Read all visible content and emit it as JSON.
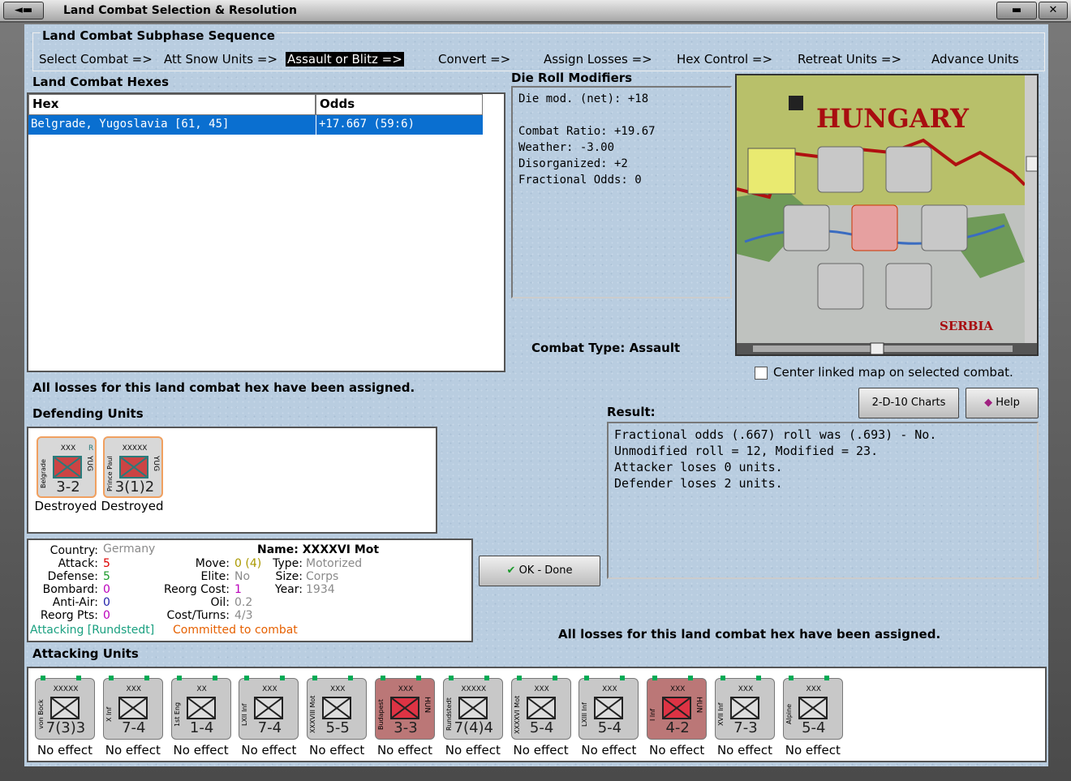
{
  "window": {
    "title": "Land Combat Selection & Resolution"
  },
  "sequence": {
    "header": "Land Combat Subphase Sequence",
    "steps": [
      "Select Combat =>",
      "Att Snow Units =>",
      "Assault or Blitz =>",
      "Convert =>",
      "Assign Losses =>",
      "Hex Control =>",
      "Retreat Units =>",
      "Advance Units"
    ]
  },
  "hexes": {
    "header": "Land Combat Hexes",
    "col_hex": "Hex",
    "col_odds": "Odds",
    "rows": [
      {
        "hex": "Belgrade, Yugoslavia [61, 45]",
        "odds": "+17.667 (59:6)"
      }
    ]
  },
  "modifiers": {
    "header": "Die Roll Modifiers",
    "net": "Die mod. (net): +18",
    "lines": [
      "Combat Ratio: +19.67",
      "Weather: -3.00",
      "Disorganized: +2",
      "Fractional Odds: 0"
    ]
  },
  "combat_type": {
    "label": "Combat Type:",
    "value": "Assault"
  },
  "map": {
    "region1": "HUNGARY",
    "region2": "SERBIA",
    "center_link_label": "Center linked map on selected combat."
  },
  "losses_msg": "All losses for this land combat hex have been assigned.",
  "defending": {
    "header": "Defending Units",
    "units": [
      {
        "name": "Belgrade",
        "nation": "YUG",
        "size": "XXX",
        "value": "3-2",
        "status": "Destroyed",
        "flag": "R"
      },
      {
        "name": "Prince Paul",
        "nation": "YUG",
        "size": "XXXXX",
        "value": "3(1)2",
        "status": "Destroyed"
      }
    ]
  },
  "buttons": {
    "charts": "2-D-10 Charts",
    "help": "Help",
    "ok": "OK - Done"
  },
  "result": {
    "header": "Result:",
    "lines": [
      "Fractional odds (.667) roll was (.693)  - No.",
      "Unmodified roll = 12, Modified = 23.",
      "Attacker loses 0 units.",
      "Defender loses 2 units."
    ]
  },
  "info": {
    "country_l": "Country:",
    "country": "Germany",
    "attack_l": "Attack:",
    "attack": "5",
    "defense_l": "Defense:",
    "defense": "5",
    "bombard_l": "Bombard:",
    "bombard": "0",
    "antiair_l": "Anti-Air:",
    "antiair": "0",
    "reorg_l": "Reorg Pts:",
    "reorg": "0",
    "name_l": "Name:",
    "name": "XXXXVI Mot",
    "move_l": "Move:",
    "move": "0",
    "move2": "(4)",
    "type_l": "Type:",
    "type": "Motorized",
    "elite_l": "Elite:",
    "elite": "No",
    "size_l": "Size:",
    "size": "Corps",
    "rcost_l": "Reorg Cost:",
    "rcost": "1",
    "year_l": "Year:",
    "year": "1934",
    "oil_l": "Oil:",
    "oil": "0.2",
    "ct_l": "Cost/Turns:",
    "ct": "4/3",
    "attacking": "Attacking [Rundstedt]",
    "committed": "Committed to combat"
  },
  "attacking": {
    "header": "Attacking Units",
    "units": [
      {
        "name": "von Bock",
        "size": "XXXXX",
        "value": "7(3)3",
        "status": "No effect",
        "red": false
      },
      {
        "name": "X Inf",
        "size": "XXX",
        "value": "7-4",
        "status": "No effect",
        "red": false
      },
      {
        "name": "1st Eng",
        "size": "XX",
        "value": "1-4",
        "status": "No effect",
        "red": false
      },
      {
        "name": "LXII Inf",
        "size": "XXX",
        "value": "7-4",
        "status": "No effect",
        "red": false
      },
      {
        "name": "XXXVIII Mot",
        "size": "XXX",
        "value": "5-5",
        "status": "No effect",
        "red": false
      },
      {
        "name": "Budapest",
        "size": "XXX",
        "value": "3-3",
        "status": "No effect",
        "red": true,
        "nation": "HUN"
      },
      {
        "name": "Rundstedt",
        "size": "XXXXX",
        "value": "7(4)4",
        "status": "No effect",
        "red": false
      },
      {
        "name": "XXXXVI Mot",
        "size": "XXX",
        "value": "5-4",
        "status": "No effect",
        "red": false
      },
      {
        "name": "LXIII Inf",
        "size": "XXX",
        "value": "5-4",
        "status": "No effect",
        "red": false
      },
      {
        "name": "I Inf",
        "size": "XXX",
        "value": "4-2",
        "status": "No effect",
        "red": true,
        "nation": "HUN"
      },
      {
        "name": "XVII Inf",
        "size": "XXX",
        "value": "7-3",
        "status": "No effect",
        "red": false
      },
      {
        "name": "Alpine",
        "size": "XXX",
        "value": "5-4",
        "status": "No effect",
        "red": false
      }
    ]
  }
}
